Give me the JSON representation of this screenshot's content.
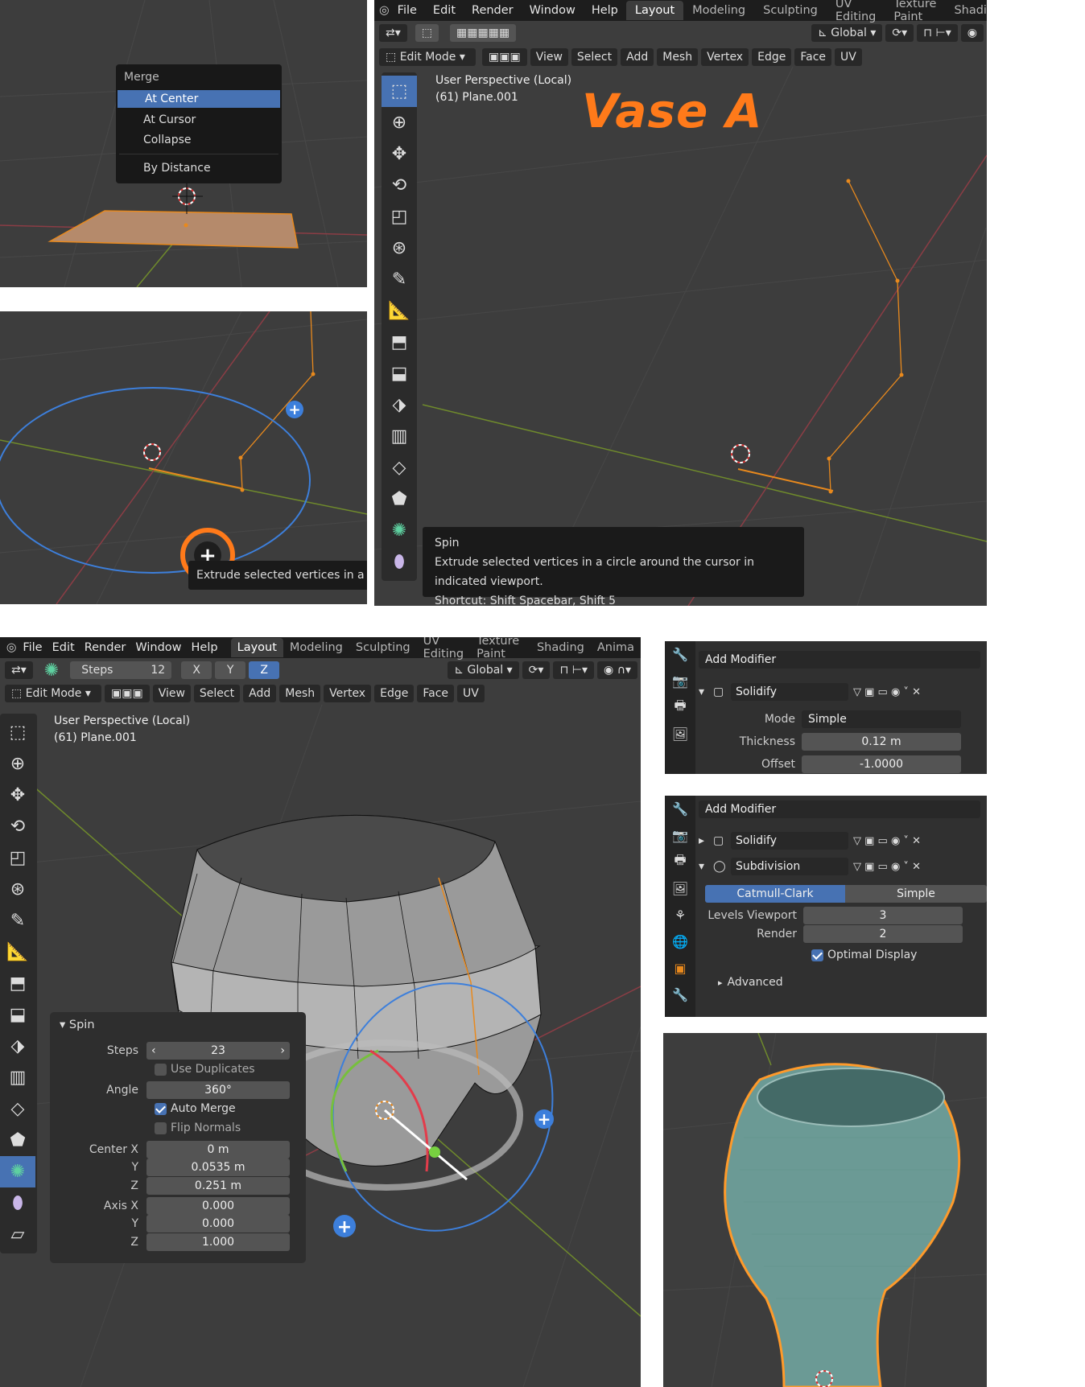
{
  "merge_menu": {
    "title": "Merge",
    "items": [
      "At Center",
      "At Cursor",
      "Collapse",
      "By Distance"
    ]
  },
  "spin_tooltip_small": {
    "text": "Extrude selected vertices in a circle"
  },
  "main": {
    "menus": [
      "File",
      "Edit",
      "Render",
      "Window",
      "Help"
    ],
    "workspaces": [
      "Layout",
      "Modeling",
      "Sculpting",
      "UV Editing",
      "Texture Paint",
      "Shading"
    ],
    "orientation": "Global",
    "mode": "Edit Mode",
    "header_menus": [
      "View",
      "Select",
      "Add",
      "Mesh",
      "Vertex",
      "Edge",
      "Face",
      "UV"
    ],
    "overlay_line1": "User Perspective (Local)",
    "overlay_line2": "(61) Plane.001",
    "title_overlay": "Vase A",
    "tooltip": {
      "title": "Spin",
      "desc": "Extrude selected vertices in a circle around the cursor in indicated viewport.",
      "shortcut": "Shortcut: Shift Spacebar, Shift 5"
    }
  },
  "bottom": {
    "menus": [
      "File",
      "Edit",
      "Render",
      "Window",
      "Help"
    ],
    "workspaces": [
      "Layout",
      "Modeling",
      "Sculpting",
      "UV Editing",
      "Texture Paint",
      "Shading",
      "Anima"
    ],
    "steps_label": "Steps",
    "steps_value": "12",
    "axes": [
      "X",
      "Y",
      "Z"
    ],
    "orientation": "Global",
    "mode": "Edit Mode",
    "header_menus": [
      "View",
      "Select",
      "Add",
      "Mesh",
      "Vertex",
      "Edge",
      "Face",
      "UV"
    ],
    "overlay_line1": "User Perspective (Local)",
    "overlay_line2": "(61) Plane.001",
    "spin_panel": {
      "title": "Spin",
      "steps_label": "Steps",
      "steps_value": "23",
      "use_duplicates": "Use Duplicates",
      "angle_label": "Angle",
      "angle_value": "360°",
      "auto_merge": "Auto Merge",
      "flip_normals": "Flip Normals",
      "center_x_label": "Center X",
      "center_x": "0 m",
      "center_y_label": "Y",
      "center_y": "0.0535 m",
      "center_z_label": "Z",
      "center_z": "0.251 m",
      "axis_x_label": "Axis X",
      "axis_x": "0.000",
      "axis_y_label": "Y",
      "axis_y": "0.000",
      "axis_z_label": "Z",
      "axis_z": "1.000"
    }
  },
  "mod1": {
    "add": "Add Modifier",
    "name": "Solidify",
    "mode_label": "Mode",
    "mode_value": "Simple",
    "thick_label": "Thickness",
    "thick_value": "0.12 m",
    "offset_label": "Offset",
    "offset_value": "-1.0000"
  },
  "mod2": {
    "add": "Add Modifier",
    "solidify": "Solidify",
    "subdiv": "Subdivision",
    "opt_a": "Catmull-Clark",
    "opt_b": "Simple",
    "lv_label": "Levels Viewport",
    "lv_value": "3",
    "render_label": "Render",
    "render_value": "2",
    "optimal": "Optimal Display",
    "advanced": "Advanced"
  },
  "colors": {
    "accent": "#4772b3",
    "orange": "#ff7a1a",
    "edit_orange": "#e8891d",
    "header": "#1d1d1d",
    "viewport": "#3d3d3d"
  }
}
